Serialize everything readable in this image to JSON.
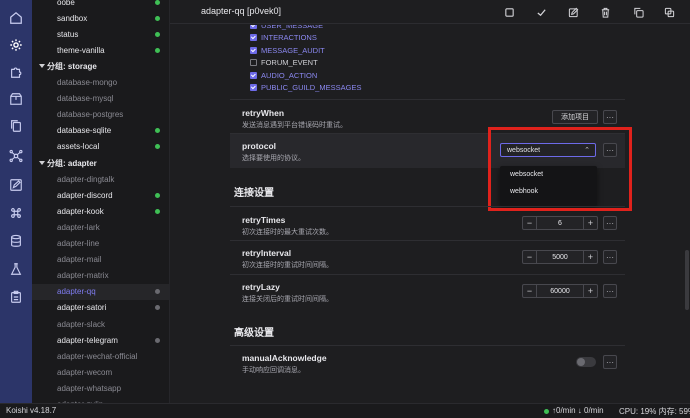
{
  "activity_bar": {
    "icons": [
      "home-icon",
      "settings-icon",
      "puzzle-icon",
      "package-icon",
      "copy-icon",
      "share-icon",
      "edit-icon",
      "command-icon",
      "database-icon",
      "flask-icon",
      "clipboard-icon"
    ],
    "active_index": 1
  },
  "sidebar": {
    "items": [
      {
        "label": "oobe",
        "kind": "item",
        "state": "normal",
        "dot": "green"
      },
      {
        "label": "sandbox",
        "kind": "item",
        "state": "normal",
        "dot": "green"
      },
      {
        "label": "status",
        "kind": "item",
        "state": "normal",
        "dot": "green"
      },
      {
        "label": "theme-vanilla",
        "kind": "item",
        "state": "normal",
        "dot": "green"
      },
      {
        "label": "分组: storage",
        "kind": "group",
        "state": "normal",
        "dot": ""
      },
      {
        "label": "database-mongo",
        "kind": "item",
        "state": "dim",
        "dot": ""
      },
      {
        "label": "database-mysql",
        "kind": "item",
        "state": "dim",
        "dot": ""
      },
      {
        "label": "database-postgres",
        "kind": "item",
        "state": "dim",
        "dot": ""
      },
      {
        "label": "database-sqlite",
        "kind": "item",
        "state": "normal",
        "dot": "green"
      },
      {
        "label": "assets-local",
        "kind": "item",
        "state": "normal",
        "dot": "green"
      },
      {
        "label": "分组: adapter",
        "kind": "group",
        "state": "normal",
        "dot": ""
      },
      {
        "label": "adapter-dingtalk",
        "kind": "item",
        "state": "dim",
        "dot": ""
      },
      {
        "label": "adapter-discord",
        "kind": "item",
        "state": "normal",
        "dot": "green"
      },
      {
        "label": "adapter-kook",
        "kind": "item",
        "state": "normal",
        "dot": "green"
      },
      {
        "label": "adapter-lark",
        "kind": "item",
        "state": "dim",
        "dot": ""
      },
      {
        "label": "adapter-line",
        "kind": "item",
        "state": "dim",
        "dot": ""
      },
      {
        "label": "adapter-mail",
        "kind": "item",
        "state": "dim",
        "dot": ""
      },
      {
        "label": "adapter-matrix",
        "kind": "item",
        "state": "dim",
        "dot": ""
      },
      {
        "label": "adapter-qq",
        "kind": "item",
        "state": "active",
        "dot": "gray"
      },
      {
        "label": "adapter-satori",
        "kind": "item",
        "state": "normal",
        "dot": "gray"
      },
      {
        "label": "adapter-slack",
        "kind": "item",
        "state": "dim",
        "dot": ""
      },
      {
        "label": "adapter-telegram",
        "kind": "item",
        "state": "normal",
        "dot": "gray"
      },
      {
        "label": "adapter-wechat-official",
        "kind": "item",
        "state": "dim",
        "dot": ""
      },
      {
        "label": "adapter-wecom",
        "kind": "item",
        "state": "dim",
        "dot": ""
      },
      {
        "label": "adapter-whatsapp",
        "kind": "item",
        "state": "dim",
        "dot": ""
      },
      {
        "label": "adapter-zulip",
        "kind": "item",
        "state": "dim",
        "dot": ""
      }
    ]
  },
  "topbar": {
    "title": "adapter-qq [p0vek0]",
    "actions": [
      "stop-icon",
      "check-icon",
      "edit-icon",
      "trash-icon",
      "copy-icon",
      "clone-icon"
    ]
  },
  "intents": [
    {
      "label": "USER_MESSAGE",
      "checked": true
    },
    {
      "label": "INTERACTIONS",
      "checked": true
    },
    {
      "label": "MESSAGE_AUDIT",
      "checked": true
    },
    {
      "label": "FORUM_EVENT",
      "checked": false
    },
    {
      "label": "AUDIO_ACTION",
      "checked": true
    },
    {
      "label": "PUBLIC_GUILD_MESSAGES",
      "checked": true
    }
  ],
  "retryWhen": {
    "name": "retryWhen",
    "desc": "发送消息遇到平台错误码时重试。",
    "add_button": "添加项目",
    "more": "···"
  },
  "protocol": {
    "name": "protocol",
    "desc": "选择要使用的协议。",
    "value": "websocket",
    "options": [
      "websocket",
      "webhook"
    ],
    "more": "···"
  },
  "section_connection": "连接设置",
  "retryTimes": {
    "name": "retryTimes",
    "desc": "初次连接时的最大重试次数。",
    "value": "6",
    "minus": "−",
    "plus": "+",
    "more": "···"
  },
  "retryInterval": {
    "name": "retryInterval",
    "desc": "初次连接时的重试时间间隔。",
    "value": "5000",
    "minus": "−",
    "plus": "+",
    "more": "···"
  },
  "retryLazy": {
    "name": "retryLazy",
    "desc": "连接关闭后的重试时间间隔。",
    "value": "60000",
    "minus": "−",
    "plus": "+",
    "more": "···"
  },
  "section_advanced": "高级设置",
  "manualAcknowledge": {
    "name": "manualAcknowledge",
    "desc": "手动响应回调消息。",
    "enabled": false,
    "more": "···"
  },
  "statusbar": {
    "version": "Koishi v4.18.7",
    "network": "0/min ↓ 0/min",
    "up_arrow": "↑",
    "cpu": "CPU: 19% 内存: 59%"
  },
  "colors": {
    "accent": "#6d6ae8",
    "activity_bg": "#2c3569",
    "highlight_box": "#e0221c",
    "status_green": "#3fbf55"
  }
}
